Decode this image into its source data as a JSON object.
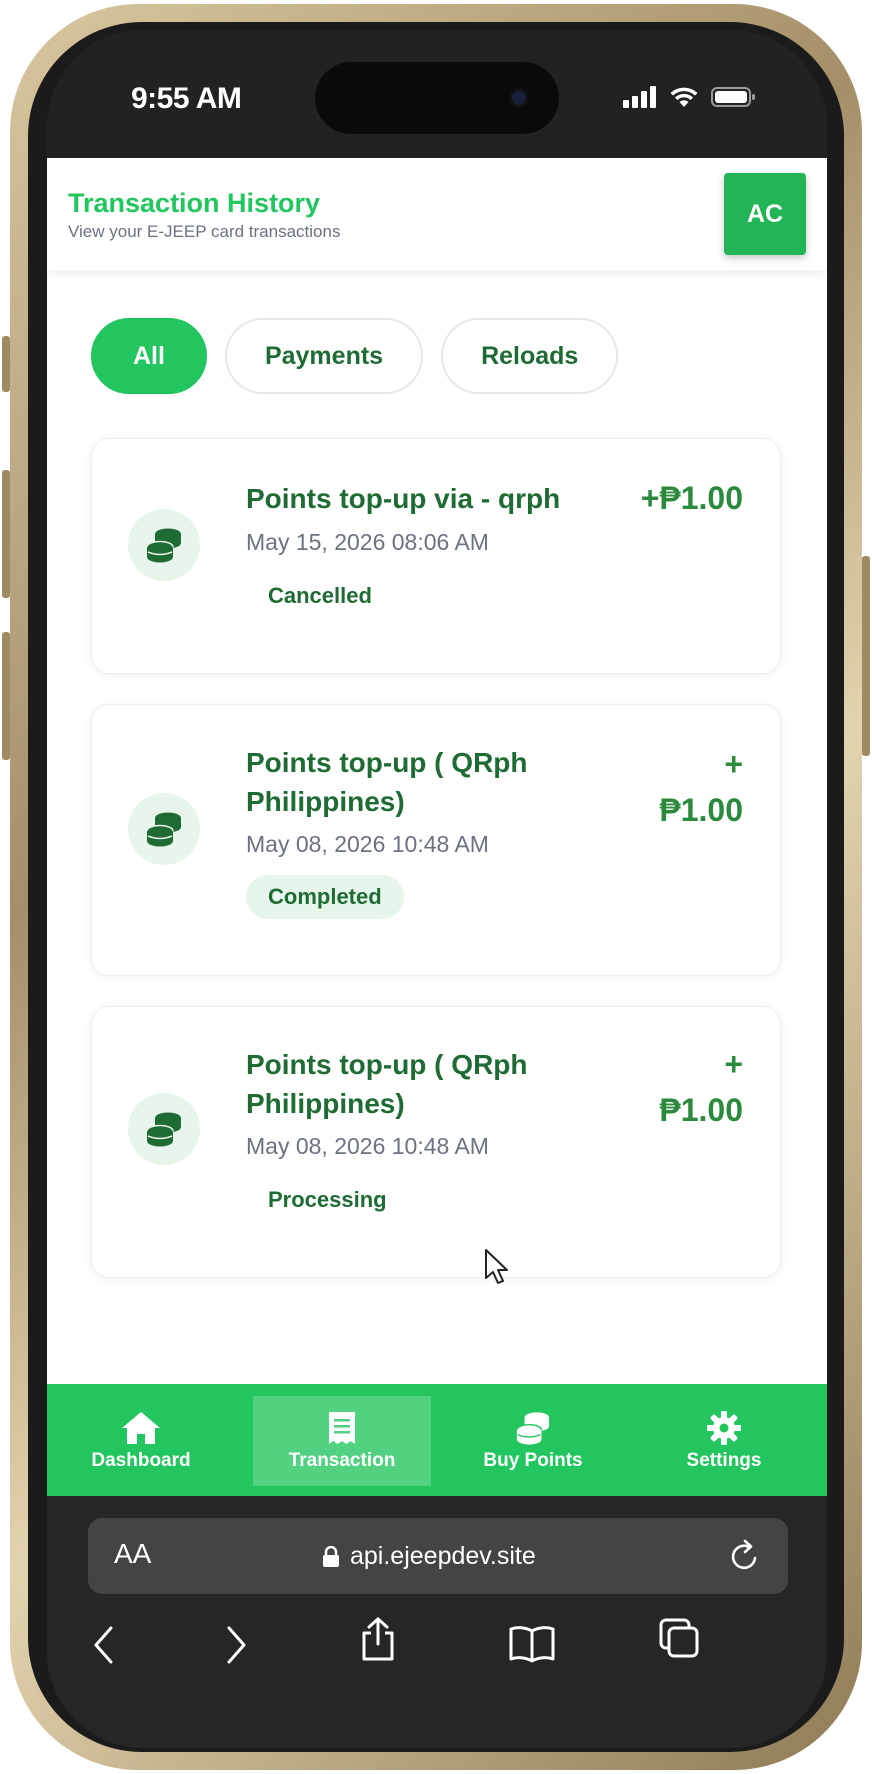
{
  "status_bar": {
    "time": "9:55 AM"
  },
  "header": {
    "title": "Transaction History",
    "subtitle": "View your E-JEEP card transactions",
    "avatar_initials": "AC"
  },
  "filters": [
    {
      "label": "All",
      "active": true
    },
    {
      "label": "Payments",
      "active": false
    },
    {
      "label": "Reloads",
      "active": false
    }
  ],
  "transactions": [
    {
      "title": "Points top-up via - qrph",
      "date": "May 15, 2026 08:06 AM",
      "status": "Cancelled",
      "amount": "+₱1.00",
      "icon": "coins-icon"
    },
    {
      "title": "Points top-up ( QRph Philippines)",
      "date": "May 08, 2026 10:48 AM",
      "status": "Completed",
      "amount_sign": "+",
      "amount_value": "₱1.00",
      "icon": "coins-icon"
    },
    {
      "title": "Points top-up ( QRph Philippines)",
      "date": "May 08, 2026 10:48 AM",
      "status": "Processing",
      "amount_sign": "+",
      "amount_value": "₱1.00",
      "icon": "coins-icon"
    }
  ],
  "bottom_nav": [
    {
      "label": "Dashboard",
      "icon": "home-icon",
      "active": false
    },
    {
      "label": "Transaction",
      "icon": "receipt-icon",
      "active": true
    },
    {
      "label": "Buy Points",
      "icon": "coins-icon",
      "active": false
    },
    {
      "label": "Settings",
      "icon": "gear-icon",
      "active": false
    }
  ],
  "browser": {
    "text_size_label": "AA",
    "url": "api.ejeepdev.site"
  },
  "colors": {
    "brand_green": "#22c55e",
    "dark_green_text": "#1f6b34",
    "amount_green": "#2b8a3e"
  }
}
